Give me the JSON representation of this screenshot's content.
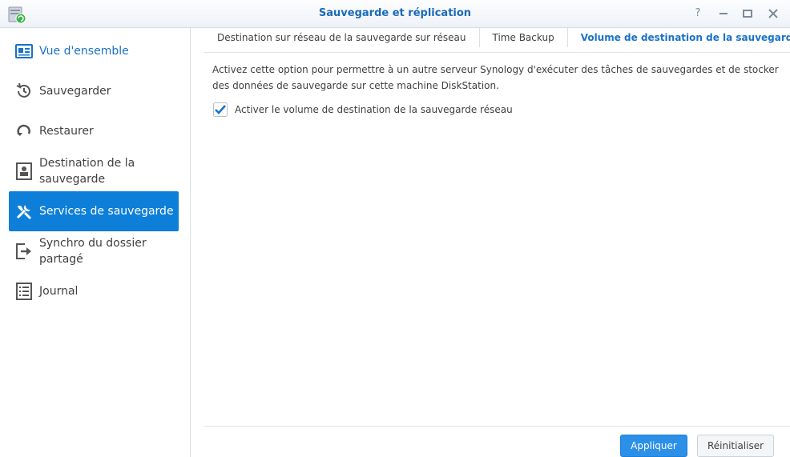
{
  "window": {
    "title": "Sauvegarde et réplication",
    "controls": {
      "help": "?",
      "minimize": "minimize-icon",
      "maximize": "maximize-icon",
      "close": "close-icon"
    }
  },
  "sidebar": {
    "items": [
      {
        "label": "Vue d'ensemble",
        "icon": "overview-icon",
        "state": "current"
      },
      {
        "label": "Sauvegarder",
        "icon": "backup-clock-icon",
        "state": "normal"
      },
      {
        "label": "Restaurer",
        "icon": "restore-icon",
        "state": "normal"
      },
      {
        "label": "Destination de la\nsauvegarde",
        "icon": "destination-icon",
        "state": "normal"
      },
      {
        "label": "Services de sauvegarde",
        "icon": "tools-icon",
        "state": "active"
      },
      {
        "label": "Synchro du dossier\npartagé",
        "icon": "share-sync-icon",
        "state": "normal"
      },
      {
        "label": "Journal",
        "icon": "log-list-icon",
        "state": "normal"
      }
    ]
  },
  "tabs": [
    {
      "label": "Destination sur réseau de la sauvegarde sur réseau",
      "selected": false
    },
    {
      "label": "Time Backup",
      "selected": false
    },
    {
      "label": "Volume de destination de la sauvegarde su",
      "selected": true
    }
  ],
  "main": {
    "description": "Activez cette option pour permettre à un autre serveur Synology d'exécuter des tâches de sauvegardes et de stocker des données de sauvegarde sur cette machine DiskStation.",
    "checkbox_label": "Activer le volume de destination de la sauvegarde réseau",
    "checkbox_checked": true
  },
  "buttons": {
    "apply": "Appliquer",
    "reset": "Réinitialiser"
  },
  "colors": {
    "accent": "#0d7fd8",
    "title": "#1a6ab8",
    "tab_selected": "#1a72c8"
  }
}
